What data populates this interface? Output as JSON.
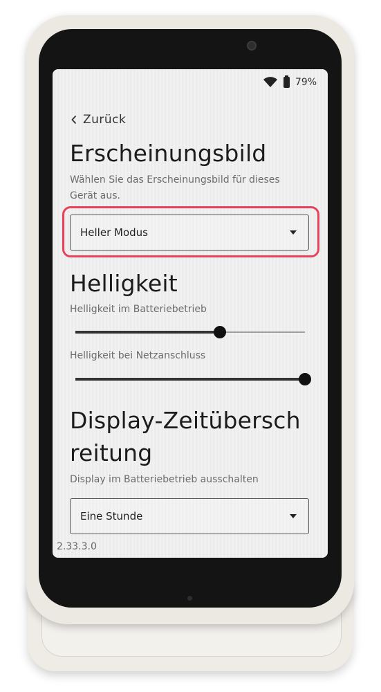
{
  "status": {
    "battery_text": "79%"
  },
  "nav": {
    "back_label": "Zurück"
  },
  "appearance": {
    "title": "Erscheinungsbild",
    "desc_line1": "Wählen Sie das Erscheinungsbild für dieses",
    "desc_line2": "Gerät aus.",
    "selected": "Heller Modus"
  },
  "brightness": {
    "title": "Helligkeit",
    "battery_label": "Helligkeit im Batteriebetrieb",
    "battery_level": 0.63,
    "mains_label": "Helligkeit bei Netzanschluss",
    "mains_level": 1.0
  },
  "timeout": {
    "title_line1": "Display-Zeitübersch",
    "title_line2": "reitung",
    "desc": "Display im Batteriebetrieb ausschalten",
    "selected": "Eine Stunde"
  },
  "footer": {
    "version": "2.33.3.0"
  },
  "colors": {
    "highlight": "#e8415a"
  },
  "icons": {
    "wifi": "wifi-icon",
    "battery": "battery-icon",
    "back": "chevron-left-icon",
    "dropdown": "triangle-down-icon"
  }
}
